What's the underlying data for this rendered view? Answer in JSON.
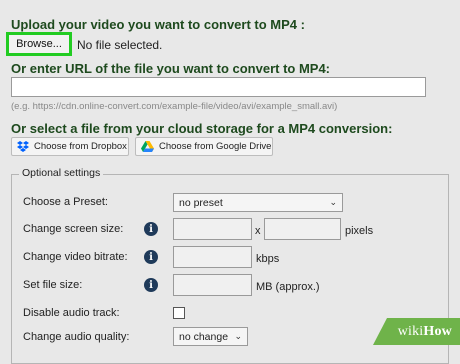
{
  "upload": {
    "heading": "Upload your video you want to convert to MP4 :",
    "browse_label": "Browse...",
    "file_status": "No file selected."
  },
  "url": {
    "heading": "Or enter URL of the file you want to convert to MP4:",
    "value": "",
    "example": "(e.g. https://cdn.online-convert.com/example-file/video/avi/example_small.avi)"
  },
  "cloud": {
    "heading": "Or select a file from your cloud storage for a MP4 conversion:",
    "dropbox_label": "Choose from Dropbox",
    "gdrive_label": "Choose from Google Drive"
  },
  "settings": {
    "legend": "Optional settings",
    "preset_label": "Choose a Preset:",
    "preset_value": "no preset",
    "screen_size_label": "Change screen size:",
    "screen_size_sep": "x",
    "screen_size_unit": "pixels",
    "bitrate_label": "Change video bitrate:",
    "bitrate_unit": "kbps",
    "file_size_label": "Set file size:",
    "file_size_unit": "MB (approx.)",
    "disable_audio_label": "Disable audio track:",
    "audio_quality_label": "Change audio quality:",
    "audio_quality_value": "no change"
  },
  "watermark": {
    "prefix": "wiki",
    "suffix": "How"
  },
  "colors": {
    "heading": "#1e4a1e",
    "highlight": "#22cc22",
    "info_icon": "#1f3a5a",
    "watermark": "#6fb34a"
  },
  "icons": [
    "dropbox-icon",
    "google-drive-icon",
    "info-icon",
    "chevron-down-icon"
  ]
}
